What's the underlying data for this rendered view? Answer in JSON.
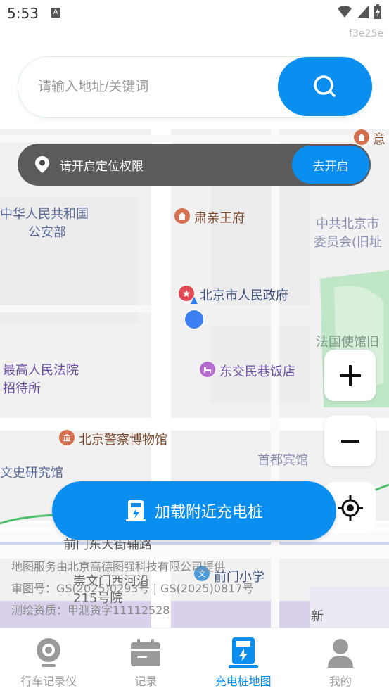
{
  "status_bar": {
    "time": "5:53",
    "hash": "f3e25e"
  },
  "search": {
    "placeholder": "请输入地址/关键词"
  },
  "location_banner": {
    "text": "请开启定位权限",
    "button": "去开启"
  },
  "map": {
    "labels": {
      "prc_security_1": "中华人民共和国",
      "prc_security_2": "公安部",
      "suqin": "肃亲王府",
      "beijing_gov": "北京市人民政府",
      "cpc_beijing_1": "中共北京市",
      "cpc_beijing_2": "委员会(旧址",
      "french_embassy": "法国使馆旧",
      "court_1": "最高人民法院",
      "court_2": "招待所",
      "dongjiao": "东交民巷饭店",
      "police_museum": "北京警察博物馆",
      "shoudu_hotel": "首都宾馆",
      "wenshi": "文史研究馆",
      "qianmen_east": "前门东大街辅路",
      "chongwen": "崇文门西河沿",
      "no215": "215号院",
      "qianmen_school": "前门小学",
      "xin": "新",
      "yi": "意"
    }
  },
  "credits": {
    "line1": "地图服务由北京高德图强科技有限公司提供",
    "line2": "审图号：GS(2025)0293号 | GS(2025)0817号",
    "line3": "测绘资质：甲测资字11112528"
  },
  "load_button": "加载附近充电桩",
  "tabs": [
    {
      "label": "行车记录仪",
      "icon": "dashcam-icon"
    },
    {
      "label": "记录",
      "icon": "calendar-icon"
    },
    {
      "label": "充电桩地图",
      "icon": "charger-icon",
      "active": true
    },
    {
      "label": "我的",
      "icon": "user-icon"
    }
  ],
  "colors": {
    "accent": "#0a8ef0",
    "banner": "#464646"
  }
}
